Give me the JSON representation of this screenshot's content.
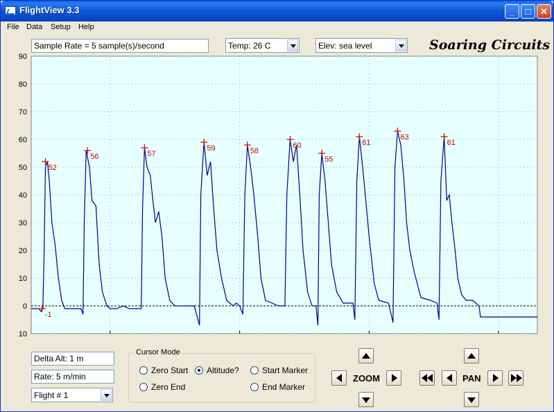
{
  "window": {
    "title": "FlightView 3.3"
  },
  "menu": {
    "items": [
      "File",
      "Data",
      "Setup",
      "Help"
    ]
  },
  "toolbar": {
    "sample_rate": "Sample Rate =  5 sample(s)/second",
    "temp": "Temp:  26 C",
    "elev": "Elev: sea level",
    "brand": "Soaring Circuits"
  },
  "readouts": {
    "delta_alt": "Delta Alt: 1 m",
    "rate": "Rate: 5 m/min",
    "flight": "Flight # 1"
  },
  "cursor_mode": {
    "title": "Cursor Mode",
    "options": [
      {
        "label": "Zero Start",
        "selected": false
      },
      {
        "label": "Altitude?",
        "selected": true
      },
      {
        "label": "Start Marker",
        "selected": false
      },
      {
        "label": "Zero End",
        "selected": false
      },
      {
        "label": "End Marker",
        "selected": false
      }
    ]
  },
  "controls": {
    "zoom_label": "ZOOM",
    "pan_label": "PAN"
  },
  "colors": {
    "plot_bg": "#e6ffff",
    "trace": "#000080",
    "marker": "#cc0000",
    "window_bg": "#ece9d8"
  },
  "chart_data": {
    "type": "line",
    "title": "",
    "xlabel": "",
    "ylabel": "",
    "xlim": [
      0.78,
      8.6
    ],
    "ylim": [
      -10,
      90
    ],
    "y_ticks": [
      90,
      80,
      70,
      60,
      50,
      40,
      30,
      20,
      10,
      0,
      -10
    ],
    "x_ticks": [
      2,
      4,
      6,
      8
    ],
    "y_tick_labels": [
      "90",
      "80",
      "70",
      "60",
      "50",
      "40",
      "30",
      "20",
      "10",
      "0",
      "10"
    ],
    "grid": "dotted",
    "zero_line": 0,
    "peaks": [
      {
        "x": 1.0,
        "y": 52,
        "label": "52"
      },
      {
        "x": 1.65,
        "y": 56,
        "label": "56"
      },
      {
        "x": 2.53,
        "y": 57,
        "label": "57"
      },
      {
        "x": 3.45,
        "y": 59,
        "label": "59"
      },
      {
        "x": 4.12,
        "y": 58,
        "label": "58"
      },
      {
        "x": 4.78,
        "y": 60,
        "label": "60"
      },
      {
        "x": 5.27,
        "y": 55,
        "label": "55"
      },
      {
        "x": 5.85,
        "y": 61,
        "label": "61"
      },
      {
        "x": 6.44,
        "y": 63,
        "label": "63"
      },
      {
        "x": 7.16,
        "y": 61,
        "label": "61"
      }
    ],
    "start_marker": {
      "x": 0.95,
      "y": -1,
      "label": "-1"
    },
    "series": [
      {
        "points": [
          [
            0.78,
            -1
          ],
          [
            0.9,
            -1
          ],
          [
            0.93,
            -2
          ],
          [
            0.96,
            -1
          ],
          [
            0.98,
            20
          ],
          [
            1.0,
            50
          ],
          [
            1.03,
            52
          ],
          [
            1.06,
            45
          ],
          [
            1.1,
            30
          ],
          [
            1.15,
            22
          ],
          [
            1.2,
            10
          ],
          [
            1.25,
            2
          ],
          [
            1.3,
            -1
          ],
          [
            1.55,
            -1
          ],
          [
            1.58,
            -3
          ],
          [
            1.6,
            30
          ],
          [
            1.63,
            56
          ],
          [
            1.68,
            50
          ],
          [
            1.72,
            38
          ],
          [
            1.78,
            36
          ],
          [
            1.83,
            15
          ],
          [
            1.88,
            5
          ],
          [
            1.95,
            0
          ],
          [
            2.0,
            -1
          ],
          [
            2.1,
            -1
          ],
          [
            2.2,
            0
          ],
          [
            2.3,
            -1
          ],
          [
            2.45,
            -1
          ],
          [
            2.48,
            -1
          ],
          [
            2.5,
            35
          ],
          [
            2.53,
            57
          ],
          [
            2.57,
            50
          ],
          [
            2.62,
            47
          ],
          [
            2.65,
            40
          ],
          [
            2.7,
            30
          ],
          [
            2.75,
            34
          ],
          [
            2.8,
            25
          ],
          [
            2.85,
            10
          ],
          [
            2.92,
            2
          ],
          [
            3.0,
            0
          ],
          [
            3.3,
            0
          ],
          [
            3.38,
            -7
          ],
          [
            3.4,
            40
          ],
          [
            3.45,
            59
          ],
          [
            3.5,
            47
          ],
          [
            3.55,
            52
          ],
          [
            3.6,
            35
          ],
          [
            3.65,
            20
          ],
          [
            3.72,
            10
          ],
          [
            3.8,
            2
          ],
          [
            3.9,
            0
          ],
          [
            3.95,
            1
          ],
          [
            4.0,
            0
          ],
          [
            4.05,
            -3
          ],
          [
            4.08,
            40
          ],
          [
            4.12,
            58
          ],
          [
            4.17,
            50
          ],
          [
            4.22,
            40
          ],
          [
            4.28,
            25
          ],
          [
            4.33,
            10
          ],
          [
            4.4,
            2
          ],
          [
            4.5,
            1
          ],
          [
            4.6,
            0
          ],
          [
            4.7,
            0
          ],
          [
            4.73,
            40
          ],
          [
            4.78,
            60
          ],
          [
            4.83,
            52
          ],
          [
            4.88,
            58
          ],
          [
            4.93,
            40
          ],
          [
            4.98,
            20
          ],
          [
            5.05,
            5
          ],
          [
            5.12,
            0
          ],
          [
            5.18,
            0
          ],
          [
            5.21,
            -7
          ],
          [
            5.23,
            40
          ],
          [
            5.27,
            55
          ],
          [
            5.32,
            45
          ],
          [
            5.37,
            30
          ],
          [
            5.42,
            15
          ],
          [
            5.5,
            5
          ],
          [
            5.6,
            1
          ],
          [
            5.75,
            1
          ],
          [
            5.78,
            -5
          ],
          [
            5.81,
            45
          ],
          [
            5.85,
            61
          ],
          [
            5.9,
            50
          ],
          [
            5.95,
            38
          ],
          [
            6.0,
            25
          ],
          [
            6.08,
            8
          ],
          [
            6.15,
            2
          ],
          [
            6.3,
            1
          ],
          [
            6.37,
            -6
          ],
          [
            6.4,
            50
          ],
          [
            6.44,
            63
          ],
          [
            6.49,
            58
          ],
          [
            6.54,
            45
          ],
          [
            6.58,
            30
          ],
          [
            6.63,
            20
          ],
          [
            6.7,
            12
          ],
          [
            6.8,
            3
          ],
          [
            6.95,
            2
          ],
          [
            7.05,
            1
          ],
          [
            7.08,
            -5
          ],
          [
            7.11,
            45
          ],
          [
            7.16,
            61
          ],
          [
            7.2,
            38
          ],
          [
            7.24,
            40
          ],
          [
            7.28,
            30
          ],
          [
            7.33,
            20
          ],
          [
            7.37,
            10
          ],
          [
            7.43,
            4
          ],
          [
            7.5,
            2
          ],
          [
            7.6,
            2
          ],
          [
            7.7,
            0
          ],
          [
            7.72,
            -4
          ],
          [
            8.0,
            -4
          ],
          [
            8.6,
            -4
          ]
        ]
      }
    ]
  }
}
